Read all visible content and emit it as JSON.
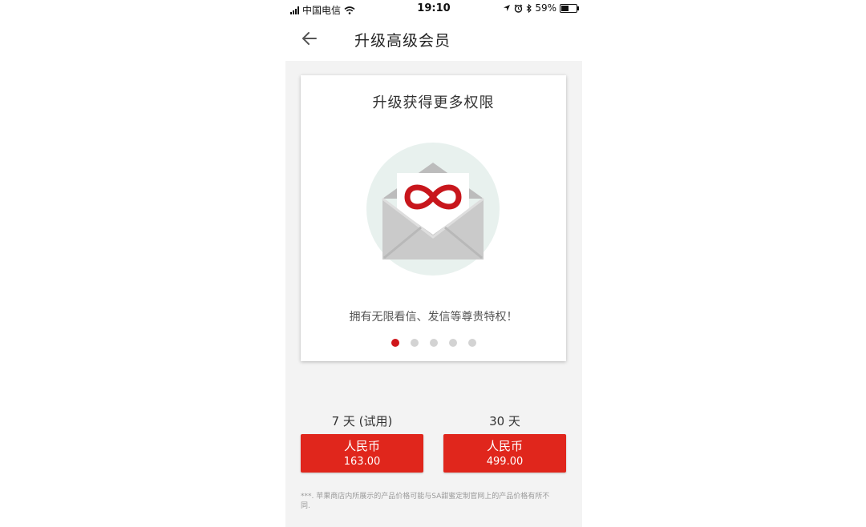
{
  "status_bar": {
    "carrier": "中国电信",
    "time": "19:10",
    "battery": "59%",
    "battery_level": 0.59
  },
  "nav": {
    "title": "升级高级会员"
  },
  "card": {
    "title": "升级获得更多权限",
    "description": "拥有无限看信、发信等尊贵特权！",
    "slides_total": 5,
    "slide_active": 1
  },
  "plans": [
    {
      "duration": "7 天 (试用)",
      "currency": "人民币",
      "price": "163.00"
    },
    {
      "duration": "30 天",
      "currency": "人民币",
      "price": "499.00"
    }
  ],
  "disclaimer": "***. 苹果商店内所展示的产品价格可能与SA甜蜜定制官网上的产品价格有所不同.",
  "colors": {
    "accent": "#e0261c",
    "dot_active": "#d0161b",
    "dot_inactive": "#d3d3d3",
    "illustration_circle": "#e8f1ee",
    "envelope": "#c8c8c8"
  }
}
